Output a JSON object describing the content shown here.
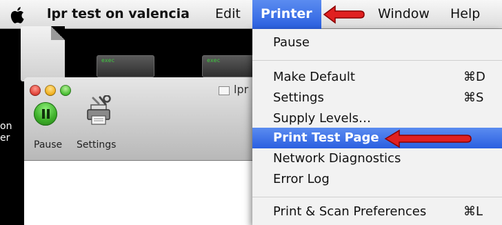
{
  "menubar": {
    "app_name": "lpr test on valencia",
    "items": [
      "Edit",
      "Printer",
      "Window",
      "Help"
    ]
  },
  "desktop": {
    "exec_label": "exec",
    "side_text_1": "on",
    "side_text_2": "er"
  },
  "window": {
    "title": "lpr",
    "toolbar": {
      "pause_label": "Pause",
      "settings_label": "Settings"
    }
  },
  "printer_menu": {
    "items": [
      {
        "label": "Pause",
        "shortcut": ""
      },
      {
        "label": "Make Default",
        "shortcut": "⌘D"
      },
      {
        "label": "Settings",
        "shortcut": "⌘S"
      },
      {
        "label": "Supply Levels…",
        "shortcut": ""
      },
      {
        "label": "Print Test Page",
        "shortcut": "",
        "highlighted": true
      },
      {
        "label": "Network Diagnostics",
        "shortcut": ""
      },
      {
        "label": "Error Log",
        "shortcut": ""
      },
      {
        "label": "Print & Scan Preferences",
        "shortcut": "⌘L"
      }
    ]
  },
  "colors": {
    "highlight": "#2a5fe0",
    "annotation_arrow": "#e02020"
  },
  "icons": [
    "apple-icon",
    "pause-icon",
    "printer-settings-icon",
    "document-icon"
  ]
}
